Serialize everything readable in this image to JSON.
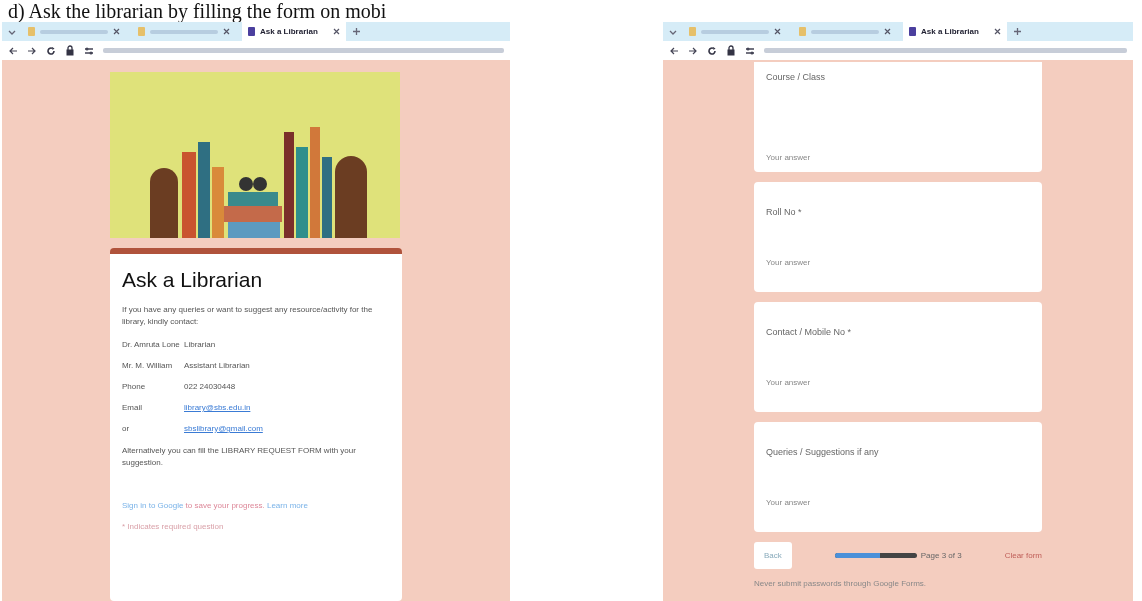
{
  "heading": "d) Ask the librarian by filling the form on mobi",
  "screens": [
    {
      "kind": "intro",
      "tabs": [
        {
          "selected": false
        },
        {
          "selected": false
        },
        {
          "selected": true,
          "label": "Ask a Librarian"
        }
      ],
      "form": {
        "title": "Ask a Librarian",
        "description": "If you have any queries or want to suggest any resource/activity for the library, kindly contact:",
        "contacts": [
          {
            "name": "Dr. Amruta Lone",
            "role": "Librarian",
            "kind": "plain"
          },
          {
            "name": "Mr. M. William",
            "role": "Assistant Librarian",
            "kind": "plain"
          },
          {
            "name": "Phone",
            "role": "022 24030448",
            "kind": "plain"
          },
          {
            "name": "Email",
            "role": "library@sbs.edu.in",
            "kind": "link"
          },
          {
            "name": "or",
            "role": "sbslibrary@gmail.com",
            "kind": "link"
          }
        ],
        "note": "Alternatively you can fill the LIBRARY REQUEST FORM with your suggestion.",
        "signin_link": "Sign in to Google",
        "signin_text": "to save your progress.",
        "learn_more": "Learn more",
        "required_note": "* Indicates required question"
      }
    },
    {
      "kind": "questions",
      "tabs": [
        {
          "selected": false
        },
        {
          "selected": false
        },
        {
          "selected": true,
          "label": "Ask a Librarian"
        }
      ],
      "form": {
        "questions": [
          {
            "label": "Course / Class",
            "placeholder": "Your answer"
          },
          {
            "label": "Roll No *",
            "placeholder": "Your answer"
          },
          {
            "label": "Contact / Mobile No *",
            "placeholder": "Your answer"
          },
          {
            "label": "Queries / Suggestions if any",
            "placeholder": "Your answer"
          }
        ],
        "back": "Back",
        "progress": {
          "level": 0.55
        },
        "page": "Page 3 of 3",
        "clear": "Clear form",
        "footer": "Never submit passwords through Google Forms."
      }
    }
  ]
}
